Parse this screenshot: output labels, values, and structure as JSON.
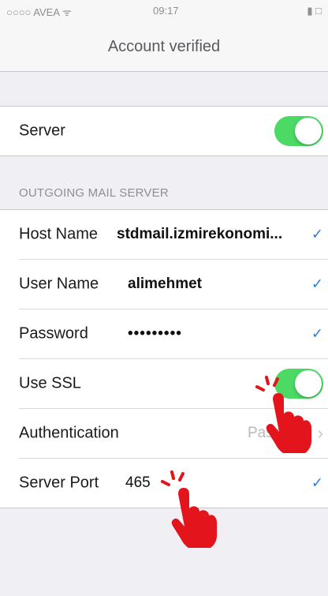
{
  "status_bar": {
    "carrier": "○○○○ AVEA ᯤ",
    "time": "09:17",
    "battery": "▮ □"
  },
  "nav": {
    "title": "Account verified"
  },
  "server_group": {
    "server": {
      "label": "Server",
      "on": true
    }
  },
  "outgoing": {
    "header": "OUTGOING MAIL SERVER",
    "host_name": {
      "label": "Host Name",
      "value": "stdmail.izmirekonomi..."
    },
    "user_name": {
      "label": "User Name",
      "value": "alimehmet"
    },
    "password": {
      "label": "Password",
      "value": "•••••••••"
    },
    "use_ssl": {
      "label": "Use SSL",
      "on": true
    },
    "authentication": {
      "label": "Authentication",
      "value": "Passw"
    },
    "server_port": {
      "label": "Server Port",
      "value": "465"
    }
  },
  "colors": {
    "toggle_on": "#4cd964",
    "check": "#2f7fe0",
    "hand": "#e3141b"
  },
  "icons": {
    "check": "checkmark-icon",
    "chevron": "chevron-right-icon",
    "pointer": "hand-pointer-icon"
  }
}
